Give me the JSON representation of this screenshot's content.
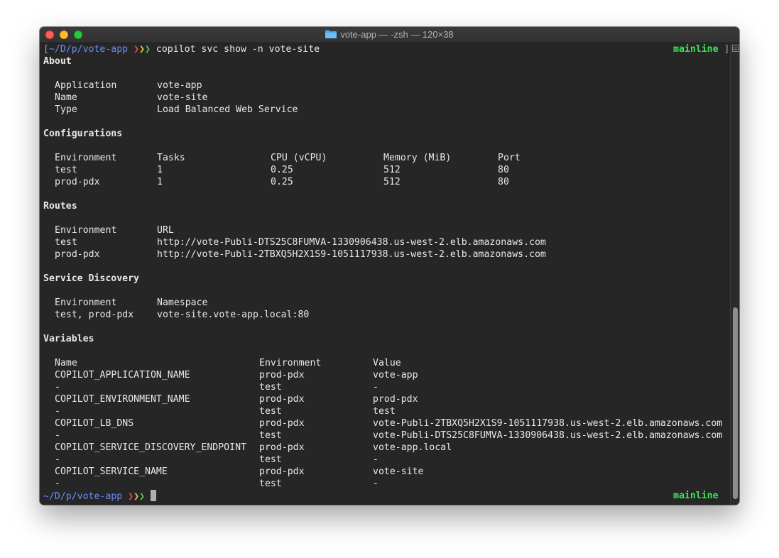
{
  "window": {
    "title": "vote-app — -zsh — 120×38"
  },
  "prompt": {
    "bracket_open": "[",
    "bracket_close": "]",
    "path": "~/D/p/vote-app",
    "command": "copilot svc show -n vote-site",
    "branch": "mainline"
  },
  "about": {
    "heading": "About",
    "rows": [
      {
        "key": "Application",
        "value": "vote-app"
      },
      {
        "key": "Name",
        "value": "vote-site"
      },
      {
        "key": "Type",
        "value": "Load Balanced Web Service"
      }
    ]
  },
  "configurations": {
    "heading": "Configurations",
    "headers": [
      "Environment",
      "Tasks",
      "CPU (vCPU)",
      "Memory (MiB)",
      "Port"
    ],
    "rows": [
      [
        "test",
        "1",
        "0.25",
        "512",
        "80"
      ],
      [
        "prod-pdx",
        "1",
        "0.25",
        "512",
        "80"
      ]
    ]
  },
  "routes": {
    "heading": "Routes",
    "headers": [
      "Environment",
      "URL"
    ],
    "rows": [
      [
        "test",
        "http://vote-Publi-DTS25C8FUMVA-1330906438.us-west-2.elb.amazonaws.com"
      ],
      [
        "prod-pdx",
        "http://vote-Publi-2TBXQ5H2X1S9-1051117938.us-west-2.elb.amazonaws.com"
      ]
    ]
  },
  "service_discovery": {
    "heading": "Service Discovery",
    "headers": [
      "Environment",
      "Namespace"
    ],
    "rows": [
      [
        "test, prod-pdx",
        "vote-site.vote-app.local:80"
      ]
    ]
  },
  "variables": {
    "heading": "Variables",
    "headers": [
      "Name",
      "Environment",
      "Value"
    ],
    "rows": [
      [
        "COPILOT_APPLICATION_NAME",
        "prod-pdx",
        "vote-app"
      ],
      [
        "-",
        "test",
        "-"
      ],
      [
        "COPILOT_ENVIRONMENT_NAME",
        "prod-pdx",
        "prod-pdx"
      ],
      [
        "-",
        "test",
        "test"
      ],
      [
        "COPILOT_LB_DNS",
        "prod-pdx",
        "vote-Publi-2TBXQ5H2X1S9-1051117938.us-west-2.elb.amazonaws.com"
      ],
      [
        "-",
        "test",
        "vote-Publi-DTS25C8FUMVA-1330906438.us-west-2.elb.amazonaws.com"
      ],
      [
        "COPILOT_SERVICE_DISCOVERY_ENDPOINT",
        "prod-pdx",
        "vote-app.local"
      ],
      [
        "-",
        "test",
        "-"
      ],
      [
        "COPILOT_SERVICE_NAME",
        "prod-pdx",
        "vote-site"
      ],
      [
        "-",
        "test",
        "-"
      ]
    ]
  },
  "colors": {
    "terminal_bg": "#262626",
    "text": "#e8e8e8",
    "path": "#6b8df5",
    "branch": "#3ee25a",
    "arrow_red": "#e0524b",
    "arrow_yellow": "#e9c23f",
    "arrow_green": "#43d35a"
  },
  "icons": {
    "folder": "folder-icon",
    "close": "close-button",
    "minimize": "minimize-button",
    "zoom": "zoom-button"
  }
}
